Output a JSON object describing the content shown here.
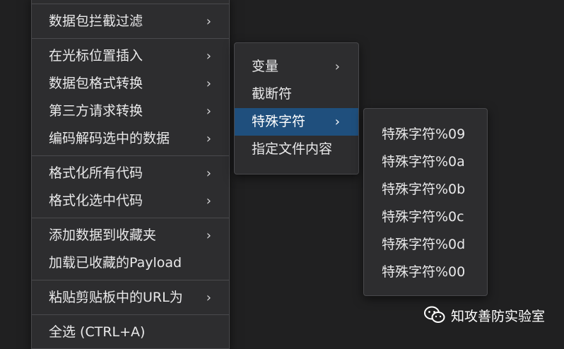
{
  "main_menu": {
    "group1": [
      {
        "label": "数据包拦截过滤",
        "has_submenu": true
      }
    ],
    "group2": [
      {
        "label": "在光标位置插入",
        "has_submenu": true
      },
      {
        "label": "数据包格式转换",
        "has_submenu": true
      },
      {
        "label": "第三方请求转换",
        "has_submenu": true
      },
      {
        "label": "编码解码选中的数据",
        "has_submenu": true
      }
    ],
    "group3": [
      {
        "label": "格式化所有代码",
        "has_submenu": true
      },
      {
        "label": "格式化选中代码",
        "has_submenu": true
      }
    ],
    "group4": [
      {
        "label": "添加数据到收藏夹",
        "has_submenu": true
      },
      {
        "label": "加载已收藏的Payload",
        "has_submenu": false
      }
    ],
    "group5": [
      {
        "label": "粘贴剪贴板中的URL为",
        "has_submenu": true
      }
    ],
    "group6": [
      {
        "label": "全选 (CTRL+A)",
        "has_submenu": false
      }
    ]
  },
  "submenu_insert": [
    {
      "label": "变量",
      "has_submenu": true
    },
    {
      "label": "截断符",
      "has_submenu": false
    },
    {
      "label": "特殊字符",
      "has_submenu": true,
      "active": true
    },
    {
      "label": "指定文件内容",
      "has_submenu": false
    }
  ],
  "submenu_special_chars": [
    {
      "label": "特殊字符%09"
    },
    {
      "label": "特殊字符%0a"
    },
    {
      "label": "特殊字符%0b"
    },
    {
      "label": "特殊字符%0c"
    },
    {
      "label": "特殊字符%0d"
    },
    {
      "label": "特殊字符%00"
    }
  ],
  "arrow_glyph": "›",
  "watermark": {
    "icon": "wechat-icon",
    "text": "知攻善防实验室"
  },
  "colors": {
    "background": "#202021",
    "menu_bg": "#2d2d2f",
    "highlight": "#1f4f7d",
    "text": "#e9e9ea"
  }
}
